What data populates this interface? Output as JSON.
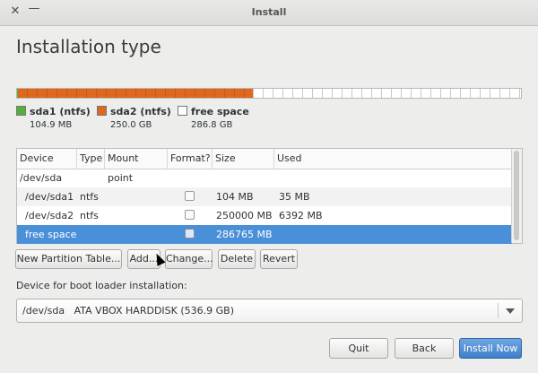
{
  "window": {
    "title": "Install",
    "close_glyph": "✕",
    "minimize_glyph": "—"
  },
  "page": {
    "title": "Installation type"
  },
  "disk_bar": {
    "total_gb": 536.9,
    "segments": [
      {
        "name": "sda1 (ntfs)",
        "size": "104.9 MB",
        "gb": 0.1049,
        "color": "#57b03a"
      },
      {
        "name": "sda2 (ntfs)",
        "size": "250.0 GB",
        "gb": 250.0,
        "color": "#e0671e"
      },
      {
        "name": "free space",
        "size": "286.8 GB",
        "gb": 286.8,
        "color": "#ffffff"
      }
    ]
  },
  "table": {
    "columns": [
      "Device",
      "Type",
      "Mount point",
      "Format?",
      "Size",
      "Used"
    ],
    "rows": [
      {
        "device": "/dev/sda",
        "type": "",
        "mount": "",
        "format": null,
        "size": "",
        "used": ""
      },
      {
        "device": "/dev/sda1",
        "type": "ntfs",
        "mount": "",
        "format": false,
        "size": "104 MB",
        "used": "35 MB"
      },
      {
        "device": "/dev/sda2",
        "type": "ntfs",
        "mount": "",
        "format": false,
        "size": "250000 MB",
        "used": "6392 MB"
      },
      {
        "device": "free space",
        "type": "",
        "mount": "",
        "format": false,
        "size": "286765 MB",
        "used": "",
        "selected": true
      }
    ]
  },
  "partition_buttons": {
    "new_table": "New Partition Table...",
    "add": "Add...",
    "change": "Change...",
    "delete": "Delete",
    "revert": "Revert"
  },
  "bootloader": {
    "label": "Device for boot loader installation:",
    "value": "/dev/sda   ATA VBOX HARDDISK (536.9 GB)"
  },
  "footer": {
    "quit": "Quit",
    "back": "Back",
    "install": "Install Now"
  },
  "colors": {
    "selection": "#4a90d9",
    "accent_orange": "#e0671e",
    "accent_green": "#57b03a"
  }
}
